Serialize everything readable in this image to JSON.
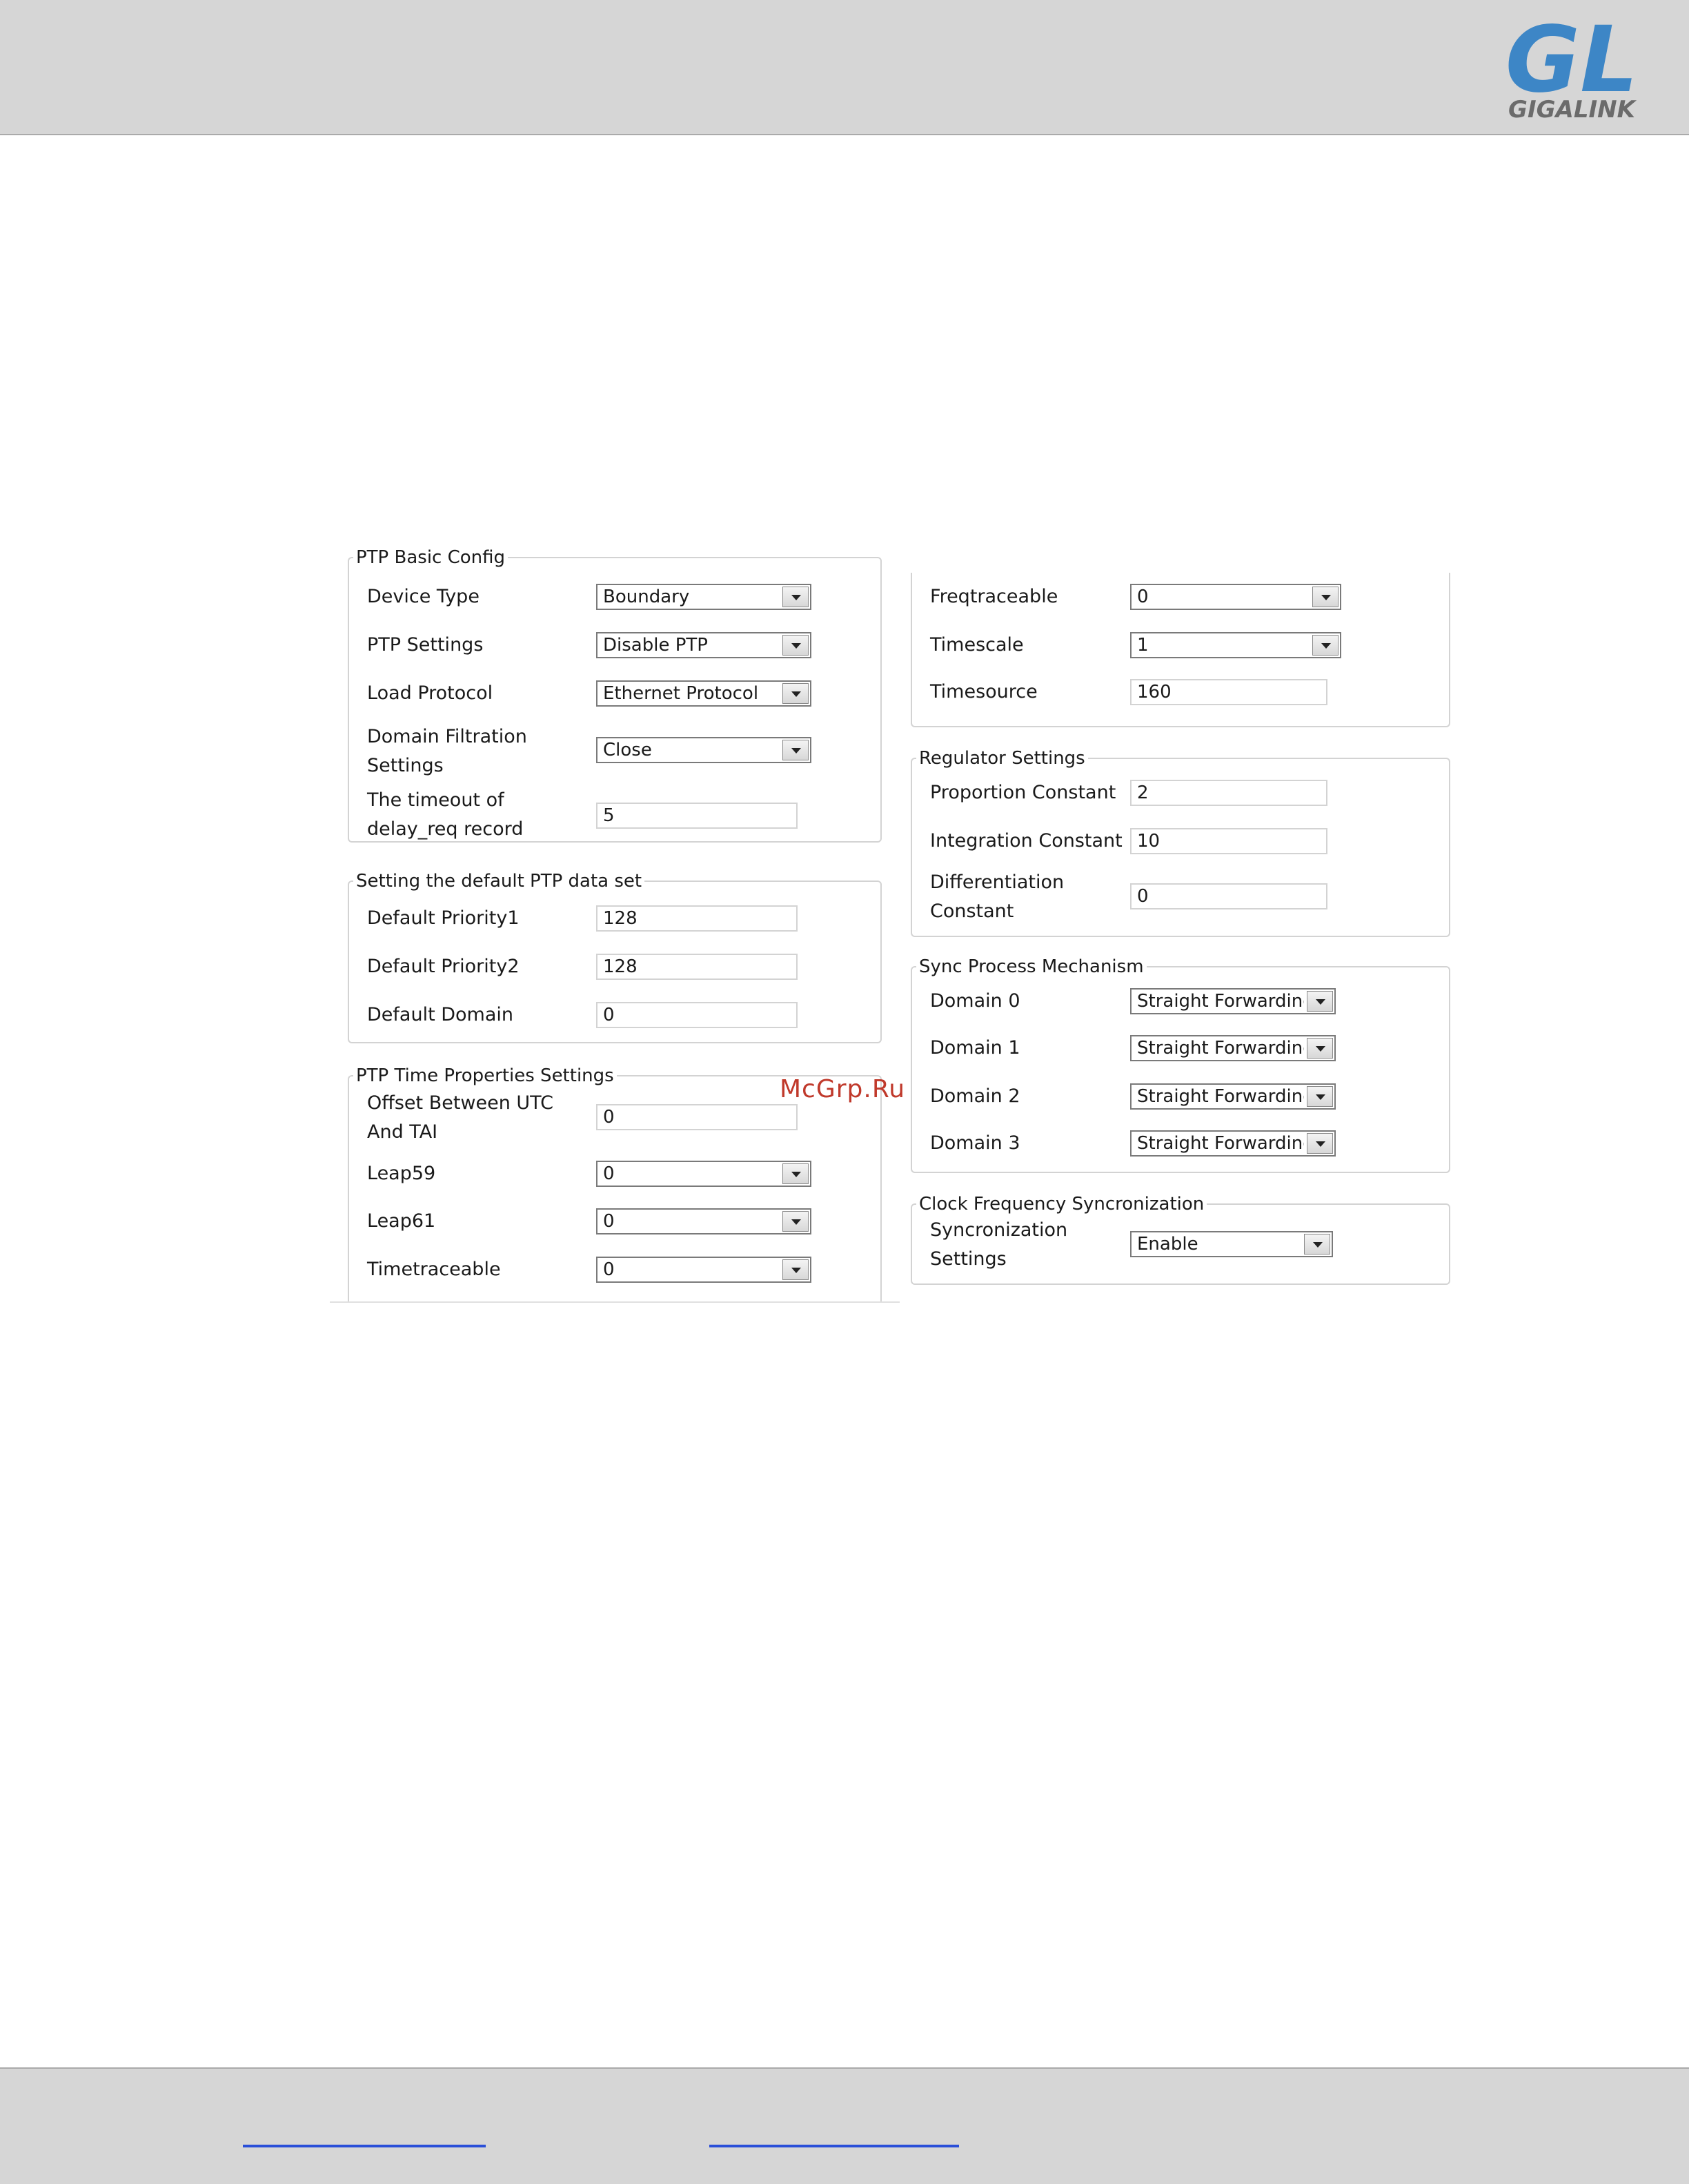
{
  "header": {
    "logo_letters": "GL",
    "logo_brand": "GIGALINK"
  },
  "watermark": "McGrp.Ru",
  "ptp_basic_config": {
    "legend": "PTP Basic Config",
    "device_type": {
      "label": "Device Type",
      "value": "Boundary"
    },
    "ptp_settings": {
      "label": "PTP Settings",
      "value": "Disable PTP"
    },
    "load_protocol": {
      "label": "Load Protocol",
      "value": "Ethernet Protocol"
    },
    "domain_filtration": {
      "label_line1": "Domain Filtration",
      "label_line2": "Settings",
      "value": "Close"
    },
    "delay_req_timeout": {
      "label_line1": "The timeout of",
      "label_line2": "delay_req record",
      "value": "5"
    }
  },
  "default_ptp_data_set": {
    "legend": "Setting the default PTP data set",
    "priority1": {
      "label": "Default Priority1",
      "value": "128"
    },
    "priority2": {
      "label": "Default Priority2",
      "value": "128"
    },
    "domain": {
      "label": "Default Domain",
      "value": "0"
    }
  },
  "time_properties": {
    "legend": "PTP Time Properties Settings",
    "utc_tai_offset": {
      "label_line1": "Offset Between UTC",
      "label_line2": "And TAI",
      "value": "0"
    },
    "leap59": {
      "label": "Leap59",
      "value": "0"
    },
    "leap61": {
      "label": "Leap61",
      "value": "0"
    },
    "timetraceable": {
      "label": "Timetraceable",
      "value": "0"
    }
  },
  "time_properties_cont": {
    "freqtraceable": {
      "label": "Freqtraceable",
      "value": "0"
    },
    "timescale": {
      "label": "Timescale",
      "value": "1"
    },
    "timesource": {
      "label": "Timesource",
      "value": "160"
    }
  },
  "regulator_settings": {
    "legend": "Regulator Settings",
    "proportion": {
      "label": "Proportion Constant",
      "value": "2"
    },
    "integration": {
      "label": "Integration Constant",
      "value": "10"
    },
    "differentiation": {
      "label_line1": "Differentiation",
      "label_line2": "Constant",
      "value": "0"
    }
  },
  "sync_process": {
    "legend": "Sync Process Mechanism",
    "domain0": {
      "label": "Domain 0",
      "value": "Straight Forwarding"
    },
    "domain1": {
      "label": "Domain 1",
      "value": "Straight Forwarding"
    },
    "domain2": {
      "label": "Domain 2",
      "value": "Straight Forwarding"
    },
    "domain3": {
      "label": "Domain 3",
      "value": "Straight Forwarding"
    }
  },
  "clock_freq_sync": {
    "legend": "Clock Frequency Syncronization",
    "sync_settings": {
      "label_line1": "Syncronization",
      "label_line2": "Settings",
      "value": "Enable"
    }
  },
  "colors": {
    "logo_blue": "#3d86c6",
    "logo_gray": "#6b6b6b",
    "link_blue": "#2a4fd8",
    "band_gray": "#d6d6d6"
  }
}
